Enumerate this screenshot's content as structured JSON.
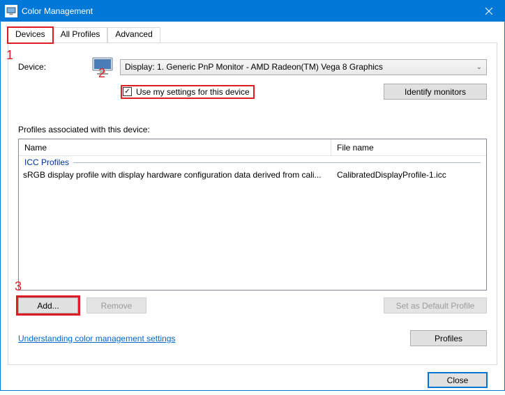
{
  "window": {
    "title": "Color Management"
  },
  "tabs": {
    "devices": "Devices",
    "allProfiles": "All Profiles",
    "advanced": "Advanced"
  },
  "device": {
    "label": "Device:",
    "selected": "Display: 1. Generic PnP Monitor - AMD Radeon(TM) Vega 8 Graphics"
  },
  "checkbox": {
    "label": "Use my settings for this device",
    "checked": true
  },
  "buttons": {
    "identify": "Identify monitors",
    "add": "Add...",
    "remove": "Remove",
    "setDefault": "Set as Default Profile",
    "profiles": "Profiles",
    "close": "Close"
  },
  "profiles": {
    "sectionLabel": "Profiles associated with this device:",
    "headerName": "Name",
    "headerFile": "File name",
    "group": "ICC Profiles",
    "rows": [
      {
        "name": "sRGB display profile with display hardware configuration data derived from cali...",
        "file": "CalibratedDisplayProfile-1.icc"
      }
    ]
  },
  "link": "Understanding color management settings",
  "annotations": {
    "n1": "1",
    "n2": "2",
    "n3": "3"
  }
}
